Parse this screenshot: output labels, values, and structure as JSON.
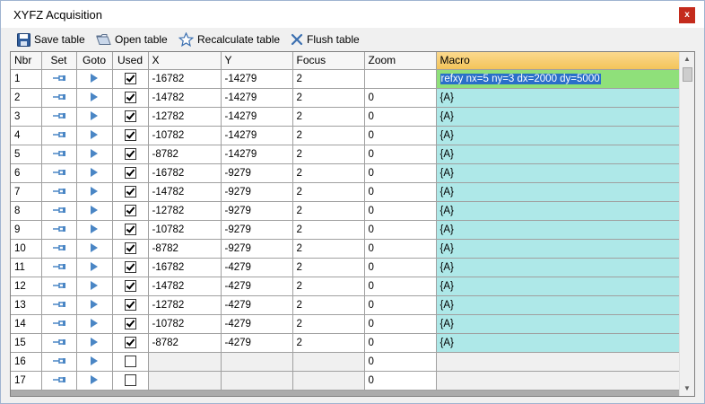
{
  "window": {
    "title": "XYFZ Acquisition",
    "close_glyph": "x"
  },
  "toolbar": {
    "save_label": "Save table",
    "open_label": "Open table",
    "recalc_label": "Recalculate table",
    "flush_label": "Flush table"
  },
  "grid": {
    "headers": {
      "nbr": "Nbr",
      "set": "Set",
      "goto": "Goto",
      "used": "Used",
      "x": "X",
      "y": "Y",
      "focus": "Focus",
      "zoom": "Zoom",
      "macro": "Macro"
    },
    "rows": [
      {
        "nbr": "1",
        "used": true,
        "x": "-16782",
        "y": "-14279",
        "focus": "2",
        "zoom": "",
        "macro": "refxy nx=5 ny=3 dx=2000 dy=5000",
        "selected": true
      },
      {
        "nbr": "2",
        "used": true,
        "x": "-14782",
        "y": "-14279",
        "focus": "2",
        "zoom": "0",
        "macro": "{A}"
      },
      {
        "nbr": "3",
        "used": true,
        "x": "-12782",
        "y": "-14279",
        "focus": "2",
        "zoom": "0",
        "macro": "{A}"
      },
      {
        "nbr": "4",
        "used": true,
        "x": "-10782",
        "y": "-14279",
        "focus": "2",
        "zoom": "0",
        "macro": "{A}"
      },
      {
        "nbr": "5",
        "used": true,
        "x": "-8782",
        "y": "-14279",
        "focus": "2",
        "zoom": "0",
        "macro": "{A}"
      },
      {
        "nbr": "6",
        "used": true,
        "x": "-16782",
        "y": "-9279",
        "focus": "2",
        "zoom": "0",
        "macro": "{A}"
      },
      {
        "nbr": "7",
        "used": true,
        "x": "-14782",
        "y": "-9279",
        "focus": "2",
        "zoom": "0",
        "macro": "{A}"
      },
      {
        "nbr": "8",
        "used": true,
        "x": "-12782",
        "y": "-9279",
        "focus": "2",
        "zoom": "0",
        "macro": "{A}"
      },
      {
        "nbr": "9",
        "used": true,
        "x": "-10782",
        "y": "-9279",
        "focus": "2",
        "zoom": "0",
        "macro": "{A}"
      },
      {
        "nbr": "10",
        "used": true,
        "x": "-8782",
        "y": "-9279",
        "focus": "2",
        "zoom": "0",
        "macro": "{A}"
      },
      {
        "nbr": "11",
        "used": true,
        "x": "-16782",
        "y": "-4279",
        "focus": "2",
        "zoom": "0",
        "macro": "{A}"
      },
      {
        "nbr": "12",
        "used": true,
        "x": "-14782",
        "y": "-4279",
        "focus": "2",
        "zoom": "0",
        "macro": "{A}"
      },
      {
        "nbr": "13",
        "used": true,
        "x": "-12782",
        "y": "-4279",
        "focus": "2",
        "zoom": "0",
        "macro": "{A}"
      },
      {
        "nbr": "14",
        "used": true,
        "x": "-10782",
        "y": "-4279",
        "focus": "2",
        "zoom": "0",
        "macro": "{A}"
      },
      {
        "nbr": "15",
        "used": true,
        "x": "-8782",
        "y": "-4279",
        "focus": "2",
        "zoom": "0",
        "macro": "{A}"
      },
      {
        "nbr": "16",
        "used": false,
        "x": "",
        "y": "",
        "focus": "",
        "zoom": "0",
        "macro": "",
        "empty": true
      },
      {
        "nbr": "17",
        "used": false,
        "x": "",
        "y": "",
        "focus": "",
        "zoom": "0",
        "macro": "",
        "empty": true
      }
    ]
  },
  "colors": {
    "macro_cell": "#aee8e8",
    "macro_selected": "#8fe07a",
    "macro_header": "#f3c45a",
    "set_icon": "#4a86c5",
    "goto_icon": "#4a86c5"
  },
  "icons": {
    "save": "floppy-disk-icon",
    "open": "folder-open-icon",
    "recalc": "star-icon",
    "flush": "cross-icon",
    "set": "pin-icon",
    "goto": "play-triangle-icon"
  }
}
